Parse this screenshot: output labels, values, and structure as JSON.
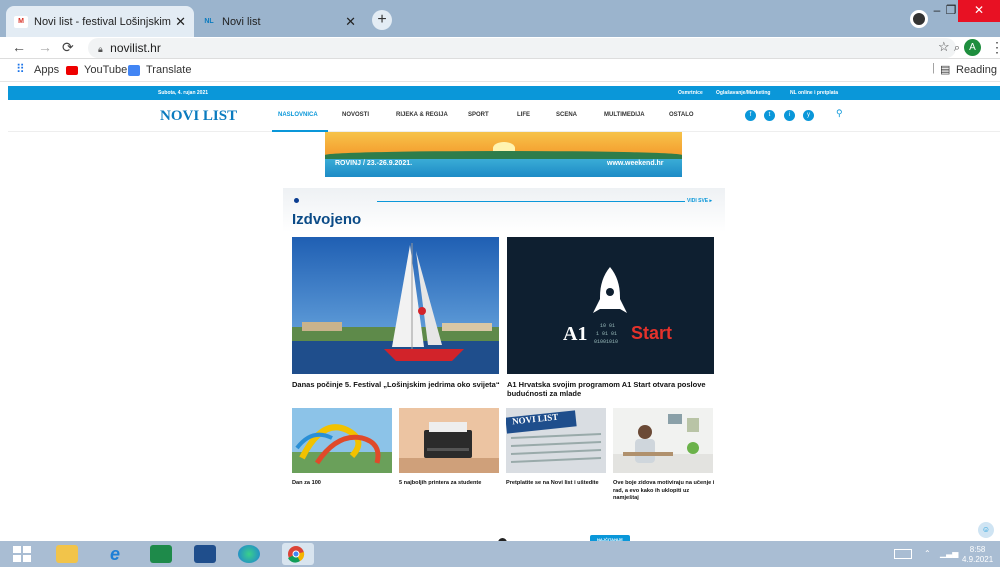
{
  "browser": {
    "tabs": [
      {
        "title": "Novi list - festival Lošinjskim jed…",
        "favicon": "gmail-icon"
      },
      {
        "title": "Novi list",
        "favicon": "NL"
      }
    ],
    "new_tab": "+",
    "url": "novilist.hr",
    "bookmarks": [
      "Apps",
      "YouTube",
      "Translate"
    ],
    "reading_list": "Reading list"
  },
  "site": {
    "date": "Subota, 4. rujan 2021",
    "top_links": [
      "Osmrtnice",
      "Oglašavanje/Marketing",
      "NL online i pretplata"
    ],
    "logo": "NOVI LIST",
    "menu": [
      "NASLOVNICA",
      "NOVOSTI",
      "RIJEKA & REGIJA",
      "SPORT",
      "LIFE",
      "SCENA",
      "MULTIMEDIJA",
      "OSTALO"
    ],
    "social_icons": [
      "f",
      "t",
      "i",
      "y"
    ]
  },
  "banner": {
    "left_text": "ROVINJ / 23.-26.9.2021.",
    "right_text": "www.weekend.hr"
  },
  "featured": {
    "title": "Izdvojeno",
    "see_all": "VIDI SVE ▸",
    "big": [
      {
        "caption": "Danas počinje 5. Festival „Lošinjskim jedrima oko svijeta“"
      },
      {
        "caption": "A1 Hrvatska svojim programom A1 Start otvara poslove budućnosti za mlade",
        "image_text_a1": "A1",
        "image_text_start": "Start",
        "image_binary": [
          "10 01",
          "1 01 01",
          "01001010"
        ]
      }
    ],
    "small": [
      {
        "caption": "Dan za 100"
      },
      {
        "caption": "5 najboljih printera za studente"
      },
      {
        "caption": "Pretplatite se na Novi list i uštedite",
        "image_text": "NOVI LIST"
      },
      {
        "caption": "Ove boje zidova motiviraju na učenje i rad, a evo kako ih uklopiti uz namještaj"
      }
    ]
  },
  "footer_pill": "NAJČITANIJE",
  "taskbar": {
    "time": "8:58",
    "date": "4.9.2021"
  },
  "colors": {
    "brand_blue": "#0a97d9",
    "tab_bar": "#9bb4cd",
    "taskbar": "#a9bdd3"
  }
}
